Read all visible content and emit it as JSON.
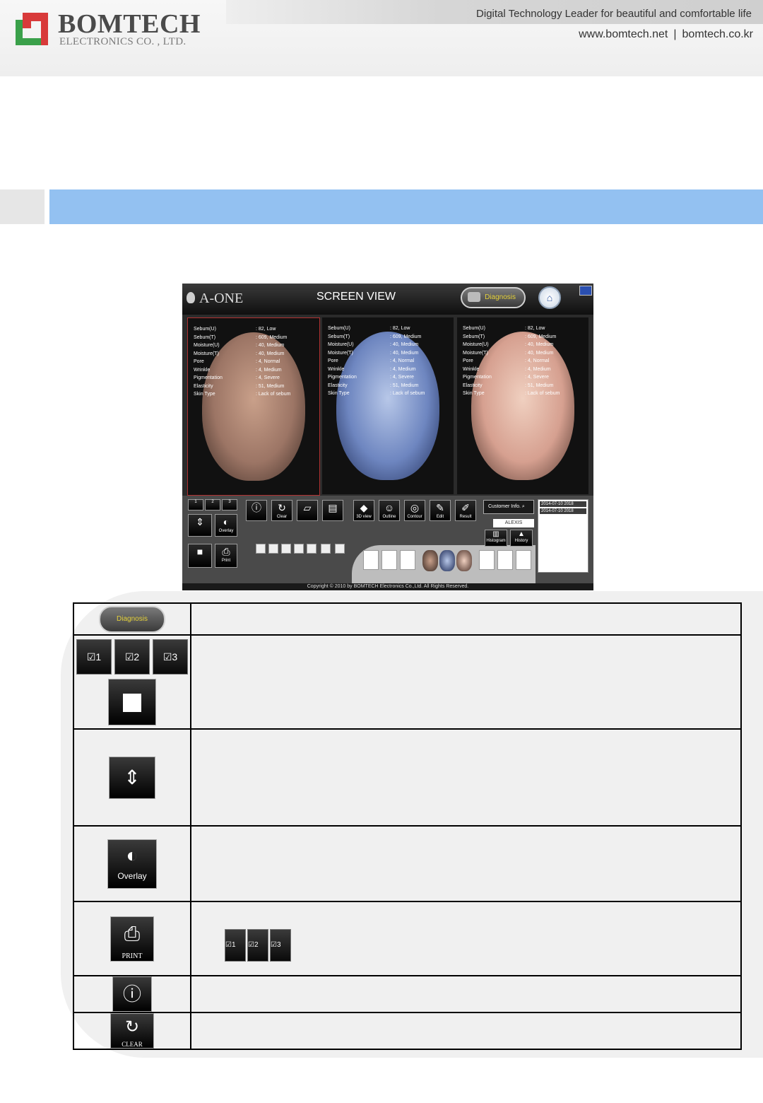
{
  "header": {
    "brand": "BOMTECH",
    "brand_sub": "ELECTRONICS CO. , LTD.",
    "tagline": "Digital Technology Leader for beautiful and comfortable life",
    "url1": "www.bomtech.net",
    "url_sep": "|",
    "url2": "bomtech.co.kr"
  },
  "app": {
    "logo": "A-ONE",
    "title": "SCREEN VIEW",
    "diagnosis_label": "Diagnosis",
    "home_icon": "home-icon",
    "panels": [
      {
        "rows": [
          {
            "k": "Sebum(U)",
            "v": ": 82, Low"
          },
          {
            "k": "Sebum(T)",
            "v": ": 609, Medium"
          },
          {
            "k": "Moisture(U)",
            "v": ": 40, Medium"
          },
          {
            "k": "Moisture(T)",
            "v": ": 40, Medium"
          },
          {
            "k": "Pore",
            "v": ": 4, Normal"
          },
          {
            "k": "Wrinkle",
            "v": ": 4, Medium"
          },
          {
            "k": "Pigmentation",
            "v": ": 4, Severe"
          },
          {
            "k": "Elasticity",
            "v": ": 51, Medium"
          },
          {
            "k": "Skin Type",
            "v": ": Lack of sebum"
          }
        ]
      },
      {
        "rows": [
          {
            "k": "Sebum(U)",
            "v": ": 82, Low"
          },
          {
            "k": "Sebum(T)",
            "v": ": 609, Medium"
          },
          {
            "k": "Moisture(U)",
            "v": ": 40, Medium"
          },
          {
            "k": "Moisture(T)",
            "v": ": 40, Medium"
          },
          {
            "k": "Pore",
            "v": ": 4, Normal"
          },
          {
            "k": "Wrinkle",
            "v": ": 4, Medium"
          },
          {
            "k": "Pigmentation",
            "v": ": 4, Severe"
          },
          {
            "k": "Elasticity",
            "v": ": 51, Medium"
          },
          {
            "k": "Skin Type",
            "v": ": Lack of sebum"
          }
        ]
      },
      {
        "rows": [
          {
            "k": "Sebum(U)",
            "v": ": 82, Low"
          },
          {
            "k": "Sebum(T)",
            "v": ": 609, Medium"
          },
          {
            "k": "Moisture(U)",
            "v": ": 40, Medium"
          },
          {
            "k": "Moisture(T)",
            "v": ": 40, Medium"
          },
          {
            "k": "Pore",
            "v": ": 4, Normal"
          },
          {
            "k": "Wrinkle",
            "v": ": 4, Medium"
          },
          {
            "k": "Pigmentation",
            "v": ": 4, Severe"
          },
          {
            "k": "Elasticity",
            "v": ": 51, Medium"
          },
          {
            "k": "Skin Type",
            "v": ": Lack of sebum"
          }
        ]
      }
    ],
    "checks": [
      "1",
      "2",
      "3"
    ],
    "overlay_label": "Overlay",
    "print_label": "Print",
    "clear_label": "Clear",
    "view3d_label": "3D view",
    "outline_label": "Outline",
    "contour_label": "Contour",
    "edit_label": "Edit",
    "result_label": "Result",
    "customer_info_label": "Customer Info.",
    "customer_name": "ALEXIS",
    "histogram_label": "Histogram",
    "history_label": "History",
    "dates": [
      "2014-07-10 2018",
      "2014-07-10 2018"
    ],
    "copyright": "Copyright © 2010 by BOMTECH Electronics Co.,Ltd. All Rights Reserved."
  },
  "table": {
    "diagnosis_label": "Diagnosis",
    "checks": [
      "1",
      "2",
      "3"
    ],
    "overlay_label": "Overlay",
    "print_label": "PRINT",
    "clear_label": "CLEAR"
  }
}
